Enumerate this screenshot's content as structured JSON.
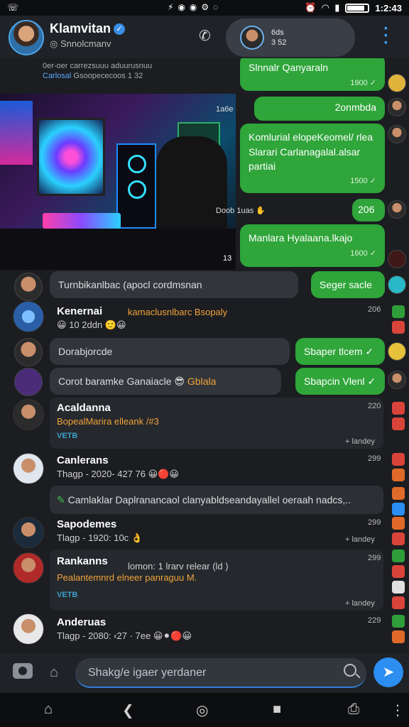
{
  "status_bar": {
    "left_icon": "whatsapp-icon",
    "time": "1:2:43",
    "notif_icons": [
      "bolt-icon",
      "circle-icon",
      "circle-icon",
      "gear-icon",
      "circle-icon"
    ]
  },
  "header": {
    "name": "Klamvitan",
    "subtitle": "Snnolcmanv",
    "pill_text_1": "6ds",
    "pill_text_2": "3 52",
    "colors": {
      "accent": "#3a8ee6",
      "bubble_green": "#2fa53a"
    }
  },
  "chat": {
    "top_note_1": "0er-oer carrezsuuu aduurusnuu",
    "top_note_2_blue": "Carlosal",
    "top_note_2": "Gsoopececoos 1 32",
    "bubbles_right": [
      {
        "text": "Slnnalr Qanyaraln",
        "time": "1900"
      },
      {
        "text": "2onmbda",
        "time": ""
      },
      {
        "text": "Komlurial elopeKeomel/ rlea",
        "text2": "Slarari Carlanagalal.alsar partiai",
        "time": "1500"
      },
      {
        "text": "206",
        "time": ""
      },
      {
        "text": "Manlara Hyalaana.lkajo",
        "time": "1600"
      }
    ],
    "photo_side_1": "1a6e",
    "photo_side_2": "Doob 1uas",
    "photo_time": "13",
    "chip_1": "Turnbikanlbac (apocl cordmsnan",
    "bubble_seg": "Seger sacle",
    "chip_2": "Dorabjorcde",
    "bubble_sh1": "Sbaper tlcem",
    "chip_3": "Corot baramke Ganaiacle",
    "chip_3_tail": "Gblala",
    "bubble_sh2": "Sbapcin Vlenl"
  },
  "rows": [
    {
      "name": "Kenernai",
      "orange": "kamaclusnlbarc Bsopaly",
      "sub": "10 2ddn",
      "time": "206",
      "teal": "",
      "foot": ""
    },
    {
      "name": "Acaldanna",
      "orange": "BopealMarira elleank /#3",
      "sub": "",
      "time": "220",
      "teal": "VETB",
      "foot": "+ landey"
    },
    {
      "name": "Canlerans",
      "orange": "",
      "sub": "Thagp - 2020- 427 76",
      "time": "299",
      "teal": "",
      "foot": ""
    },
    {
      "name": "Sapodemes",
      "orange": "",
      "sub": "Tlagp - 1920: 10c",
      "time": "299",
      "teal": "",
      "foot": "+ landey"
    },
    {
      "name": "Rankanns",
      "orange": "Pealantemnrd elneer panraguu M.",
      "sub": "lomon: 1 lrarv relear (ld )",
      "time": "299",
      "teal": "VETB",
      "foot": "+ landey"
    },
    {
      "name": "Anderuas",
      "orange": "",
      "sub": "Tlagp - 2080: ‹27 · 7ee",
      "time": "229",
      "teal": "",
      "foot": ""
    }
  ],
  "divider_note": "Camlaklar Daplranancaol clanyabldseandayallel oeraah nadcs,..",
  "input": {
    "placeholder": "Shakg/e igaer yerdaner"
  }
}
